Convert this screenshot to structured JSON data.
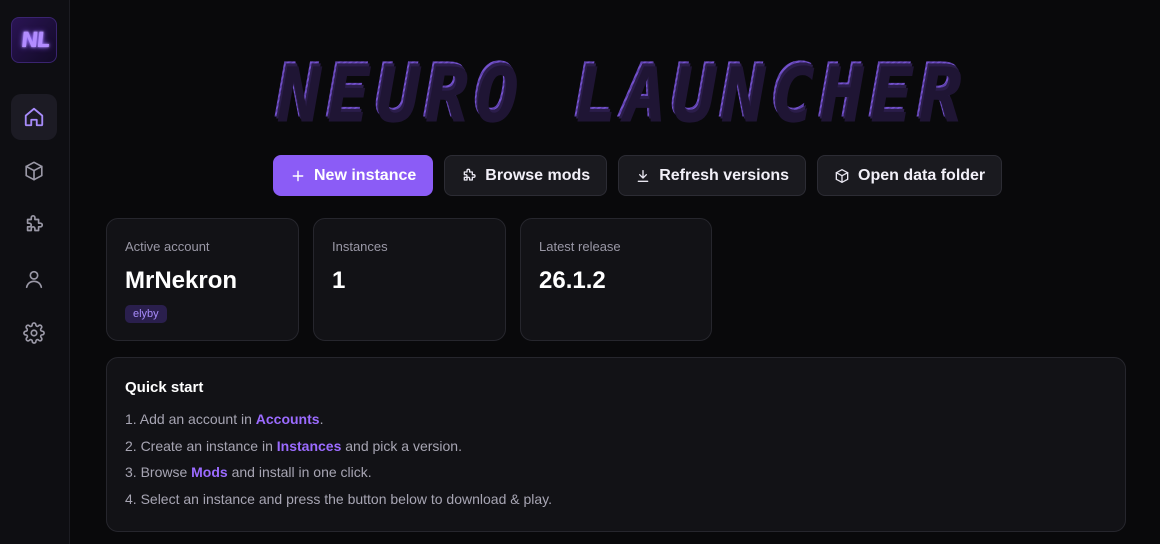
{
  "sidebar": {
    "logo": {
      "text": "NL",
      "name": "neuro-launcher-logo"
    },
    "items": [
      {
        "id": "home",
        "icon": "home-icon",
        "active": true
      },
      {
        "id": "instances",
        "icon": "cube-icon",
        "active": false
      },
      {
        "id": "mods",
        "icon": "puzzle-icon",
        "active": false
      },
      {
        "id": "accounts",
        "icon": "user-icon",
        "active": false
      },
      {
        "id": "settings",
        "icon": "gear-icon",
        "active": false
      }
    ]
  },
  "header": {
    "title": "NEURO LAUNCHER"
  },
  "actions": {
    "new_instance": {
      "label": "New instance",
      "icon": "plus-icon"
    },
    "browse_mods": {
      "label": "Browse mods",
      "icon": "puzzle-icon"
    },
    "refresh_versions": {
      "label": "Refresh versions",
      "icon": "download-icon"
    },
    "open_data_folder": {
      "label": "Open data folder",
      "icon": "cube-icon"
    }
  },
  "stats": {
    "account": {
      "label": "Active account",
      "value": "MrNekron",
      "badge": "elyby"
    },
    "instances": {
      "label": "Instances",
      "value": "1"
    },
    "release": {
      "label": "Latest release",
      "value": "26.1.2"
    }
  },
  "quick_start": {
    "title": "Quick start",
    "steps": [
      {
        "prefix": "1. Add an account in ",
        "highlight": "Accounts",
        "suffix": "."
      },
      {
        "prefix": "2. Create an instance in ",
        "highlight": "Instances",
        "suffix": " and pick a version."
      },
      {
        "prefix": "3. Browse ",
        "highlight": "Mods",
        "suffix": " and install in one click."
      },
      {
        "prefix": "4. Select an instance and press the button below to download & play.",
        "highlight": "",
        "suffix": ""
      }
    ]
  },
  "colors": {
    "accent": "#8b5cf6",
    "highlight": "#9b6bff",
    "background": "#09090b",
    "card": "#121216"
  }
}
